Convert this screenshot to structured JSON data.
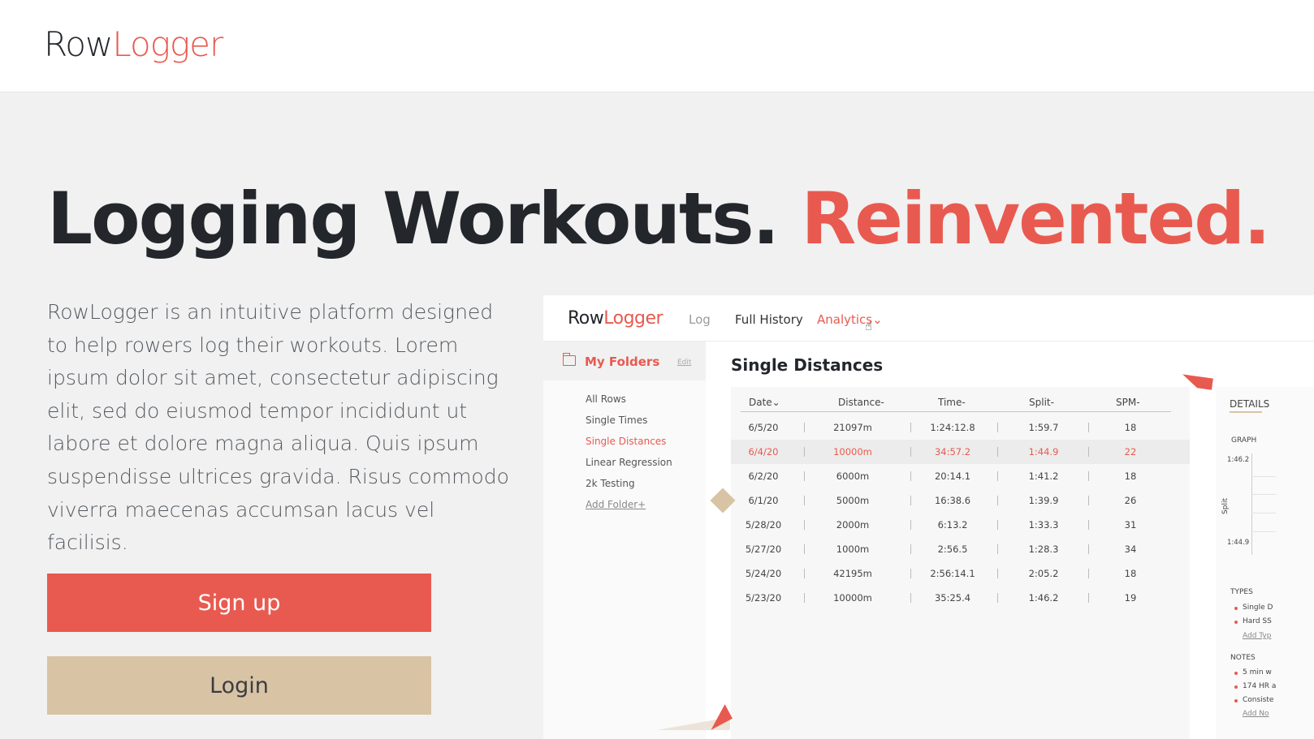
{
  "header": {
    "logo_a": "Row",
    "logo_b": "Logger"
  },
  "hero": {
    "headline_a": "Logging Workouts.",
    "headline_b": "Reinvented.",
    "description": "RowLogger is an intuitive platform designed to help rowers log their workouts. Lorem ipsum dolor sit amet, consectetur adipiscing elit, sed do eiusmod tempor incididunt ut labore et dolore magna aliqua. Quis ipsum suspendisse ultrices gravida. Risus commodo viverra maecenas accumsan lacus vel facilisis.",
    "signup_label": "Sign up",
    "login_label": "Login"
  },
  "preview": {
    "logo_a": "Row",
    "logo_b": "Logger",
    "nav": {
      "log": "Log",
      "history": "Full History",
      "analytics": "Analytics",
      "analytics_caret": "⌄"
    },
    "sidebar": {
      "title": "My Folders",
      "edit": "Edit",
      "items": [
        {
          "label": "All Rows",
          "active": false
        },
        {
          "label": "Single Times",
          "active": false
        },
        {
          "label": "Single Distances",
          "active": true
        },
        {
          "label": "Linear Regression",
          "active": false
        },
        {
          "label": "2k Testing",
          "active": false
        }
      ],
      "add": "Add Folder+"
    },
    "title": "Single Distances",
    "table": {
      "headers": [
        "Date⌄",
        "Distance-",
        "Time-",
        "Split-",
        "SPM-"
      ],
      "rows": [
        {
          "date": "6/5/20",
          "distance": "21097m",
          "time": "1:24:12.8",
          "split": "1:59.7",
          "spm": "18",
          "highlight": false
        },
        {
          "date": "6/4/20",
          "distance": "10000m",
          "time": "34:57.2",
          "split": "1:44.9",
          "spm": "22",
          "highlight": true
        },
        {
          "date": "6/2/20",
          "distance": "6000m",
          "time": "20:14.1",
          "split": "1:41.2",
          "spm": "18",
          "highlight": false
        },
        {
          "date": "6/1/20",
          "distance": "5000m",
          "time": "16:38.6",
          "split": "1:39.9",
          "spm": "26",
          "highlight": false
        },
        {
          "date": "5/28/20",
          "distance": "2000m",
          "time": "6:13.2",
          "split": "1:33.3",
          "spm": "31",
          "highlight": false
        },
        {
          "date": "5/27/20",
          "distance": "1000m",
          "time": "2:56.5",
          "split": "1:28.3",
          "spm": "34",
          "highlight": false
        },
        {
          "date": "5/24/20",
          "distance": "42195m",
          "time": "2:56:14.1",
          "split": "2:05.2",
          "spm": "18",
          "highlight": false
        },
        {
          "date": "5/23/20",
          "distance": "10000m",
          "time": "35:25.4",
          "split": "1:46.2",
          "spm": "19",
          "highlight": false
        }
      ]
    },
    "details": {
      "title": "DETAILS",
      "graph": "GRAPH",
      "graph_top": "1:46.2",
      "graph_bottom": "1:44.9",
      "split_label": "Split",
      "types_label": "TYPES",
      "types": [
        "Single D",
        "Hard SS"
      ],
      "add_type": "Add Typ",
      "notes_label": "NOTES",
      "notes": [
        "5 min w",
        "174 HR a",
        "Consiste"
      ],
      "add_note": "Add No"
    }
  },
  "colors": {
    "accent": "#e85a4f",
    "tan": "#d8c3a5",
    "dark": "#23262b",
    "background": "#f1f1f1"
  }
}
